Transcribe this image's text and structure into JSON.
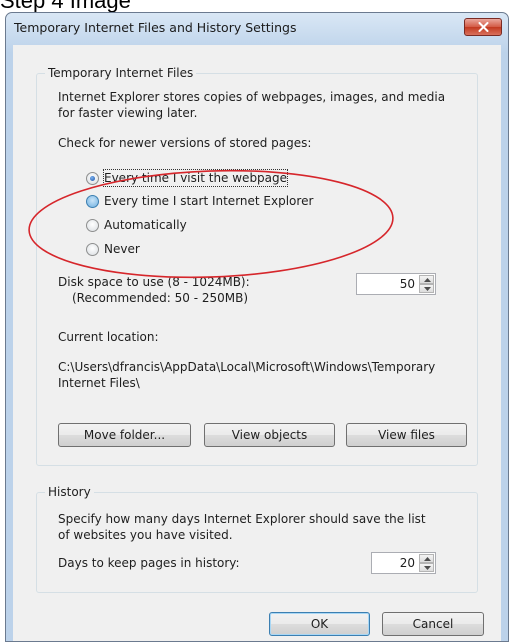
{
  "page_caption": "Step 4 Image",
  "window": {
    "title": "Temporary Internet Files and History Settings",
    "close_icon": "close-x-icon"
  },
  "temp_files": {
    "legend": "Temporary Internet Files",
    "description_line1": "Internet Explorer stores copies of webpages, images, and media",
    "description_line2": "for faster viewing later.",
    "check_label": "Check for newer versions of stored pages:",
    "options": [
      {
        "label": "Every time I visit the webpage",
        "selected": true
      },
      {
        "label": "Every time I start Internet Explorer",
        "selected": false
      },
      {
        "label": "Automatically",
        "selected": false
      },
      {
        "label": "Never",
        "selected": false
      }
    ],
    "disk_label": "Disk space to use (8 - 1024MB):",
    "disk_recommended": "(Recommended: 50 - 250MB)",
    "disk_value": "50",
    "location_label": "Current location:",
    "location_path_line1": "C:\\Users\\dfrancis\\AppData\\Local\\Microsoft\\Windows\\Temporary",
    "location_path_line2": "Internet Files\\",
    "buttons": {
      "move_folder": "Move folder...",
      "view_objects": "View objects",
      "view_files": "View files"
    }
  },
  "history": {
    "legend": "History",
    "description_line1": "Specify how many days Internet Explorer should save the list",
    "description_line2": "of websites you have visited.",
    "days_label": "Days to keep pages in history:",
    "days_value": "20"
  },
  "dialog_buttons": {
    "ok": "OK",
    "cancel": "Cancel"
  },
  "annotation": {
    "color": "#d6262b",
    "shape": "red ellipse highlighting the stored-page check options"
  }
}
